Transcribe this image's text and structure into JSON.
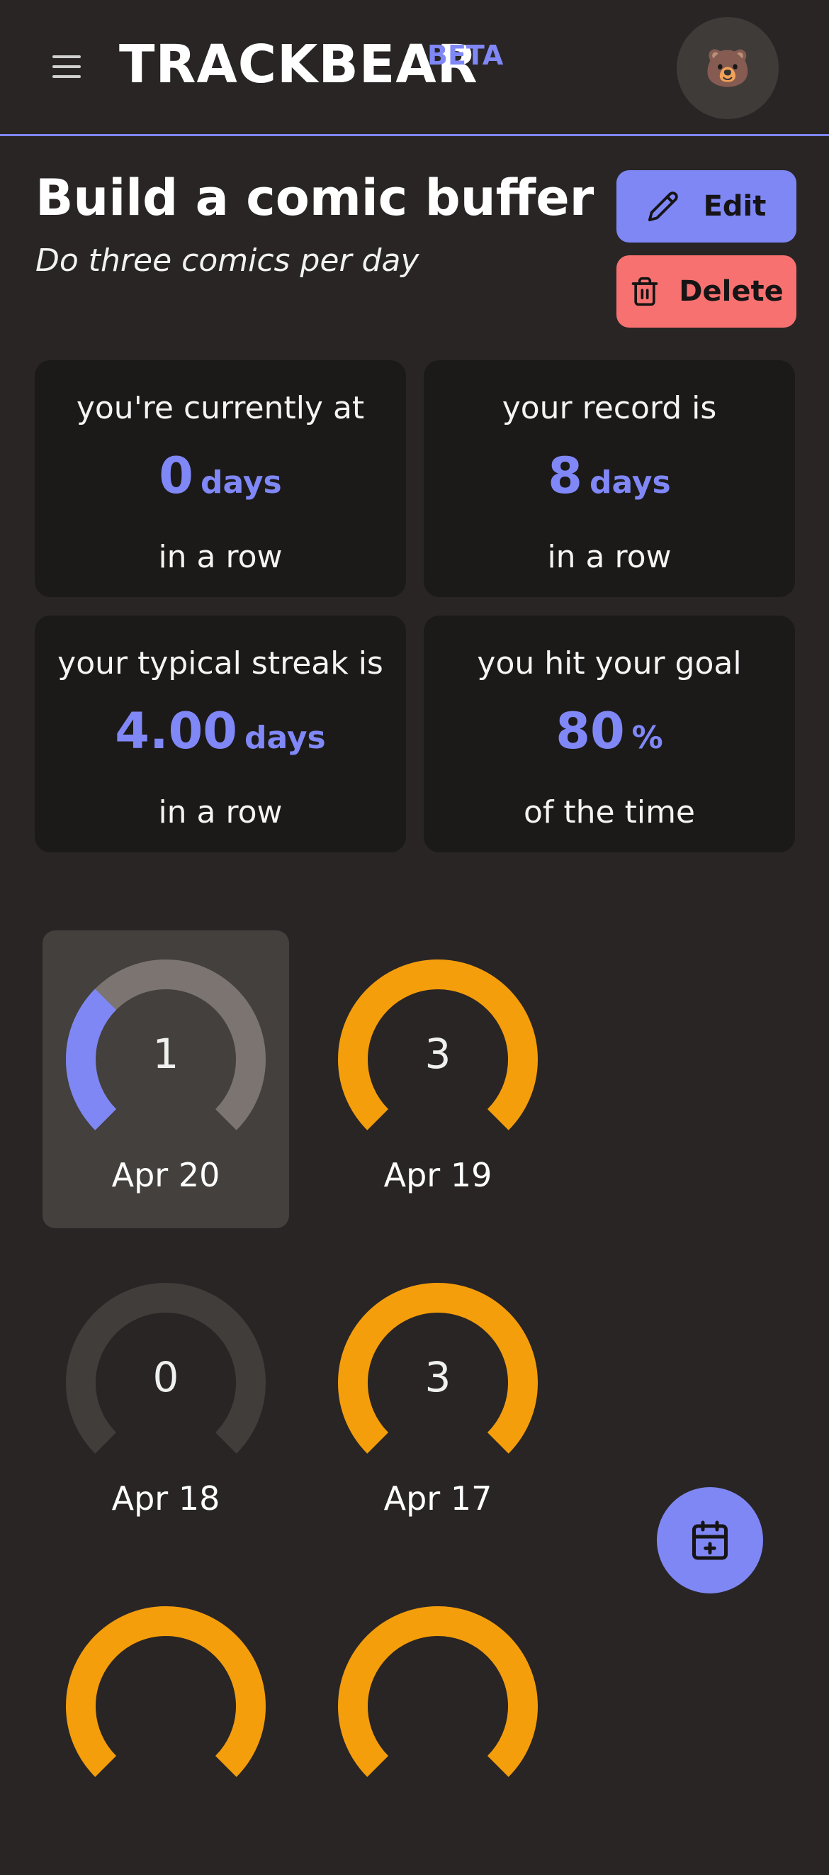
{
  "header": {
    "logo": "TRACKBEAR",
    "badge": "BETA",
    "avatar": "🐻"
  },
  "goal": {
    "title": "Build a comic buffer",
    "description": "Do three comics per day",
    "edit_label": "Edit",
    "delete_label": "Delete"
  },
  "stats": [
    {
      "label": "you're currently at",
      "value": "0",
      "unit": "days",
      "suffix": "in a row"
    },
    {
      "label": "your record is",
      "value": "8",
      "unit": "days",
      "suffix": "in a row"
    },
    {
      "label": "your typical streak is",
      "value": "4.00",
      "unit": "days",
      "suffix": "in a row"
    },
    {
      "label": "you hit your goal",
      "value": "80",
      "unit": "%",
      "suffix": "of the time"
    }
  ],
  "days": [
    {
      "count": "1",
      "date": "Apr 20",
      "progress": 0.333,
      "selected": true
    },
    {
      "count": "3",
      "date": "Apr 19",
      "progress": 1.0,
      "selected": false
    },
    {
      "count": "0",
      "date": "Apr 18",
      "progress": 0.0,
      "selected": false
    },
    {
      "count": "3",
      "date": "Apr 17",
      "progress": 1.0,
      "selected": false
    },
    {
      "count": "",
      "date": "",
      "progress": 1.0,
      "selected": false
    },
    {
      "count": "",
      "date": "",
      "progress": 1.0,
      "selected": false
    }
  ],
  "colors": {
    "accent": "#7f87f5",
    "danger": "#f87171",
    "complete": "#f59e0b",
    "track_selected": "#7b7470",
    "track_empty": "#403d3a"
  },
  "icons": {
    "menu": "hamburger-icon",
    "edit": "pencil-icon",
    "delete": "trash-icon",
    "fab": "calendar-plus-icon"
  }
}
